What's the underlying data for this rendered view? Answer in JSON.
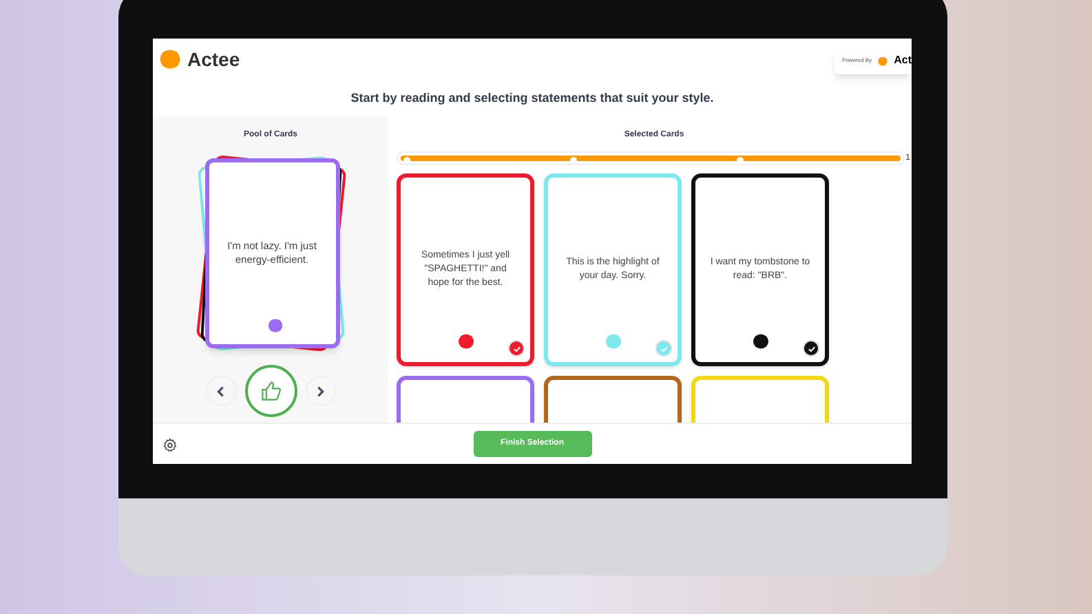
{
  "app": {
    "brand": "Actee",
    "powered_by": {
      "label": "Powered By",
      "brand": "Act"
    }
  },
  "instruction": "Start by reading and selecting statements that suit your style.",
  "pool": {
    "title": "Pool of Cards",
    "stack": [
      {
        "color": "#ef1b2d"
      },
      {
        "color": "#111111"
      },
      {
        "color": "#7de8ee"
      }
    ],
    "top_card": {
      "text": "I'm not lazy. I'm just energy-efficient.",
      "color": "#9b6cf2"
    }
  },
  "selected": {
    "title": "Selected Cards",
    "progress": {
      "level": 1,
      "end_label": "1"
    },
    "cards": [
      {
        "text": "Sometimes I just yell \"SPAGHETTI!\" and hope for the best.",
        "color": "#ef1b2d",
        "selected": true
      },
      {
        "text": "This is the highlight of your day. Sorry.",
        "color": "#7de8ee",
        "selected": true
      },
      {
        "text": "I want my tombstone to read: \"BRB\".",
        "color": "#111111",
        "selected": true
      },
      {
        "color": "#9b6cf2"
      },
      {
        "color": "#b5651d"
      },
      {
        "color": "#f2d80f"
      }
    ]
  },
  "footer": {
    "button": "Finish Selection"
  }
}
